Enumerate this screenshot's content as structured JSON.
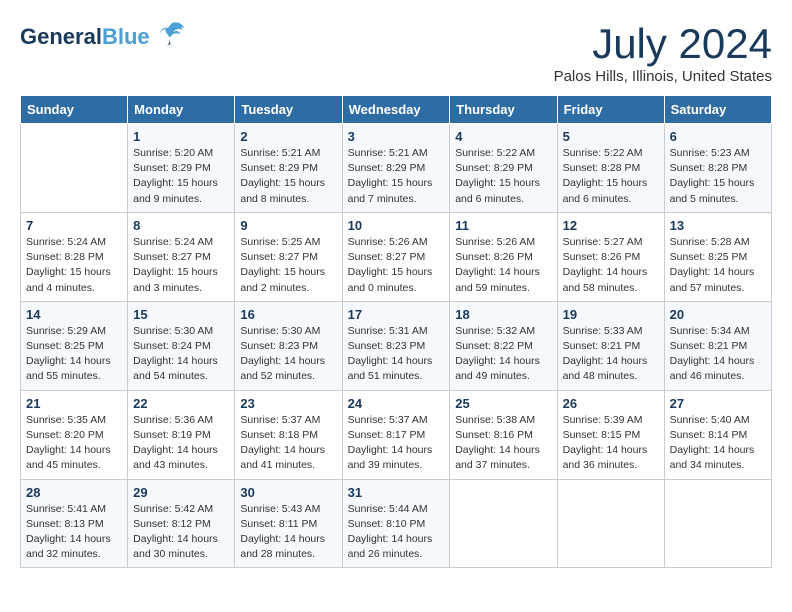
{
  "header": {
    "logo_general": "General",
    "logo_blue": "Blue",
    "month_year": "July 2024",
    "location": "Palos Hills, Illinois, United States"
  },
  "days_of_week": [
    "Sunday",
    "Monday",
    "Tuesday",
    "Wednesday",
    "Thursday",
    "Friday",
    "Saturday"
  ],
  "weeks": [
    [
      {
        "day": "",
        "sunrise": "",
        "sunset": "",
        "daylight": ""
      },
      {
        "day": "1",
        "sunrise": "Sunrise: 5:20 AM",
        "sunset": "Sunset: 8:29 PM",
        "daylight": "Daylight: 15 hours and 9 minutes."
      },
      {
        "day": "2",
        "sunrise": "Sunrise: 5:21 AM",
        "sunset": "Sunset: 8:29 PM",
        "daylight": "Daylight: 15 hours and 8 minutes."
      },
      {
        "day": "3",
        "sunrise": "Sunrise: 5:21 AM",
        "sunset": "Sunset: 8:29 PM",
        "daylight": "Daylight: 15 hours and 7 minutes."
      },
      {
        "day": "4",
        "sunrise": "Sunrise: 5:22 AM",
        "sunset": "Sunset: 8:29 PM",
        "daylight": "Daylight: 15 hours and 6 minutes."
      },
      {
        "day": "5",
        "sunrise": "Sunrise: 5:22 AM",
        "sunset": "Sunset: 8:28 PM",
        "daylight": "Daylight: 15 hours and 6 minutes."
      },
      {
        "day": "6",
        "sunrise": "Sunrise: 5:23 AM",
        "sunset": "Sunset: 8:28 PM",
        "daylight": "Daylight: 15 hours and 5 minutes."
      }
    ],
    [
      {
        "day": "7",
        "sunrise": "Sunrise: 5:24 AM",
        "sunset": "Sunset: 8:28 PM",
        "daylight": "Daylight: 15 hours and 4 minutes."
      },
      {
        "day": "8",
        "sunrise": "Sunrise: 5:24 AM",
        "sunset": "Sunset: 8:27 PM",
        "daylight": "Daylight: 15 hours and 3 minutes."
      },
      {
        "day": "9",
        "sunrise": "Sunrise: 5:25 AM",
        "sunset": "Sunset: 8:27 PM",
        "daylight": "Daylight: 15 hours and 2 minutes."
      },
      {
        "day": "10",
        "sunrise": "Sunrise: 5:26 AM",
        "sunset": "Sunset: 8:27 PM",
        "daylight": "Daylight: 15 hours and 0 minutes."
      },
      {
        "day": "11",
        "sunrise": "Sunrise: 5:26 AM",
        "sunset": "Sunset: 8:26 PM",
        "daylight": "Daylight: 14 hours and 59 minutes."
      },
      {
        "day": "12",
        "sunrise": "Sunrise: 5:27 AM",
        "sunset": "Sunset: 8:26 PM",
        "daylight": "Daylight: 14 hours and 58 minutes."
      },
      {
        "day": "13",
        "sunrise": "Sunrise: 5:28 AM",
        "sunset": "Sunset: 8:25 PM",
        "daylight": "Daylight: 14 hours and 57 minutes."
      }
    ],
    [
      {
        "day": "14",
        "sunrise": "Sunrise: 5:29 AM",
        "sunset": "Sunset: 8:25 PM",
        "daylight": "Daylight: 14 hours and 55 minutes."
      },
      {
        "day": "15",
        "sunrise": "Sunrise: 5:30 AM",
        "sunset": "Sunset: 8:24 PM",
        "daylight": "Daylight: 14 hours and 54 minutes."
      },
      {
        "day": "16",
        "sunrise": "Sunrise: 5:30 AM",
        "sunset": "Sunset: 8:23 PM",
        "daylight": "Daylight: 14 hours and 52 minutes."
      },
      {
        "day": "17",
        "sunrise": "Sunrise: 5:31 AM",
        "sunset": "Sunset: 8:23 PM",
        "daylight": "Daylight: 14 hours and 51 minutes."
      },
      {
        "day": "18",
        "sunrise": "Sunrise: 5:32 AM",
        "sunset": "Sunset: 8:22 PM",
        "daylight": "Daylight: 14 hours and 49 minutes."
      },
      {
        "day": "19",
        "sunrise": "Sunrise: 5:33 AM",
        "sunset": "Sunset: 8:21 PM",
        "daylight": "Daylight: 14 hours and 48 minutes."
      },
      {
        "day": "20",
        "sunrise": "Sunrise: 5:34 AM",
        "sunset": "Sunset: 8:21 PM",
        "daylight": "Daylight: 14 hours and 46 minutes."
      }
    ],
    [
      {
        "day": "21",
        "sunrise": "Sunrise: 5:35 AM",
        "sunset": "Sunset: 8:20 PM",
        "daylight": "Daylight: 14 hours and 45 minutes."
      },
      {
        "day": "22",
        "sunrise": "Sunrise: 5:36 AM",
        "sunset": "Sunset: 8:19 PM",
        "daylight": "Daylight: 14 hours and 43 minutes."
      },
      {
        "day": "23",
        "sunrise": "Sunrise: 5:37 AM",
        "sunset": "Sunset: 8:18 PM",
        "daylight": "Daylight: 14 hours and 41 minutes."
      },
      {
        "day": "24",
        "sunrise": "Sunrise: 5:37 AM",
        "sunset": "Sunset: 8:17 PM",
        "daylight": "Daylight: 14 hours and 39 minutes."
      },
      {
        "day": "25",
        "sunrise": "Sunrise: 5:38 AM",
        "sunset": "Sunset: 8:16 PM",
        "daylight": "Daylight: 14 hours and 37 minutes."
      },
      {
        "day": "26",
        "sunrise": "Sunrise: 5:39 AM",
        "sunset": "Sunset: 8:15 PM",
        "daylight": "Daylight: 14 hours and 36 minutes."
      },
      {
        "day": "27",
        "sunrise": "Sunrise: 5:40 AM",
        "sunset": "Sunset: 8:14 PM",
        "daylight": "Daylight: 14 hours and 34 minutes."
      }
    ],
    [
      {
        "day": "28",
        "sunrise": "Sunrise: 5:41 AM",
        "sunset": "Sunset: 8:13 PM",
        "daylight": "Daylight: 14 hours and 32 minutes."
      },
      {
        "day": "29",
        "sunrise": "Sunrise: 5:42 AM",
        "sunset": "Sunset: 8:12 PM",
        "daylight": "Daylight: 14 hours and 30 minutes."
      },
      {
        "day": "30",
        "sunrise": "Sunrise: 5:43 AM",
        "sunset": "Sunset: 8:11 PM",
        "daylight": "Daylight: 14 hours and 28 minutes."
      },
      {
        "day": "31",
        "sunrise": "Sunrise: 5:44 AM",
        "sunset": "Sunset: 8:10 PM",
        "daylight": "Daylight: 14 hours and 26 minutes."
      },
      {
        "day": "",
        "sunrise": "",
        "sunset": "",
        "daylight": ""
      },
      {
        "day": "",
        "sunrise": "",
        "sunset": "",
        "daylight": ""
      },
      {
        "day": "",
        "sunrise": "",
        "sunset": "",
        "daylight": ""
      }
    ]
  ]
}
